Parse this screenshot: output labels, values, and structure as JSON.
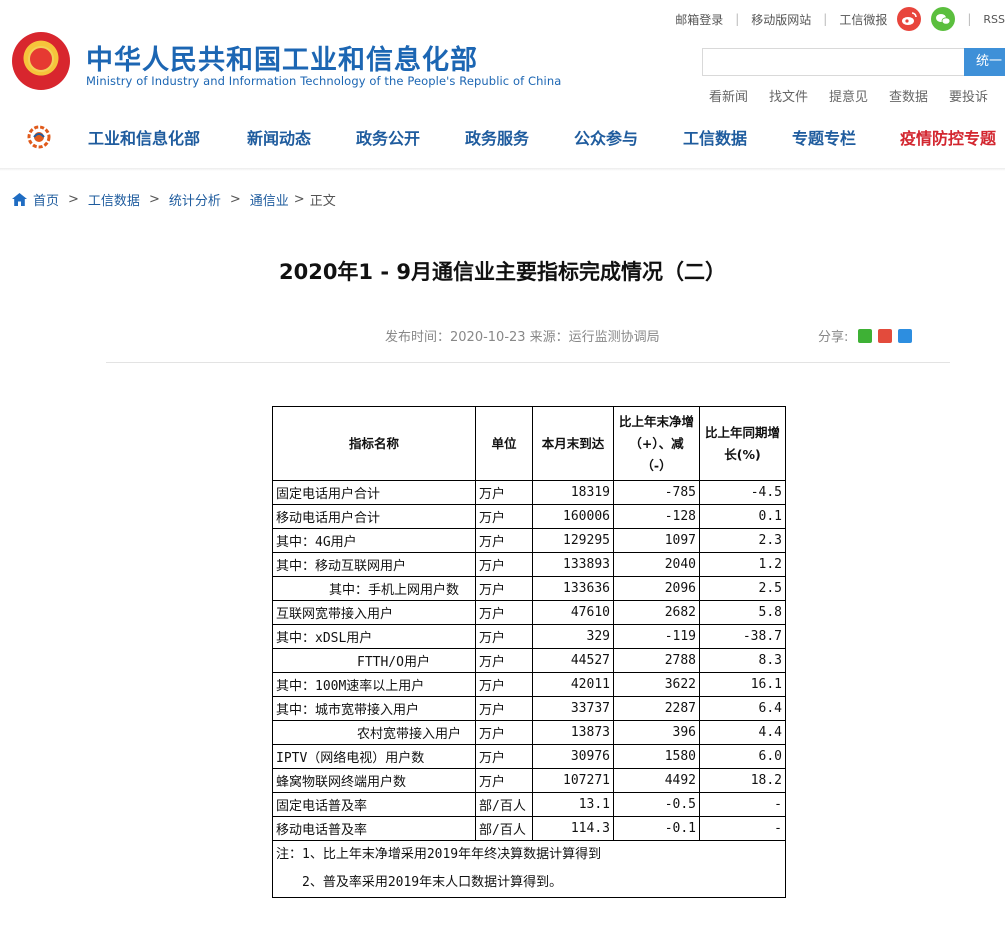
{
  "top_links": [
    "邮箱登录",
    "移动版网站",
    "工信微报"
  ],
  "rss": "RSS",
  "site": {
    "name_cn": "中华人民共和国工业和信息化部",
    "name_en": "Ministry of Industry and Information Technology of the People's Republic of China"
  },
  "search": {
    "button": "统一"
  },
  "quick_links": [
    "看新闻",
    "找文件",
    "提意见",
    "查数据",
    "要投诉"
  ],
  "nav": [
    "工业和信息化部",
    "新闻动态",
    "政务公开",
    "政务服务",
    "公众参与",
    "工信数据",
    "专题专栏",
    "疫情防控专题"
  ],
  "breadcrumb": [
    "首页",
    "工信数据",
    "统计分析",
    "通信业",
    "正文"
  ],
  "article": {
    "title": "2020年1 - 9月通信业主要指标完成情况（二）",
    "meta": "发布时间：2020-10-23  来源：运行监测协调局",
    "share_label": "分享:"
  },
  "table": {
    "headers": [
      "指标名称",
      "单位",
      "本月末到达",
      "比上年末净增（+）、减（-）",
      "比上年同期增长(%)"
    ],
    "header_lines": {
      "net": [
        "比上年末净增",
        "（+）、减",
        "（-）"
      ],
      "growth": [
        "比上年同期增",
        "长(%)"
      ]
    },
    "rows": [
      {
        "name": "固定电话用户合计",
        "indent": 0,
        "unit": "万户",
        "value": "18319",
        "net": "-785",
        "growth": "-4.5"
      },
      {
        "name": "移动电话用户合计",
        "indent": 0,
        "unit": "万户",
        "value": "160006",
        "net": "-128",
        "growth": "0.1"
      },
      {
        "name": "其中：4G用户",
        "indent": 0,
        "unit": "万户",
        "value": "129295",
        "net": "1097",
        "growth": "2.3"
      },
      {
        "name": "其中：移动互联网用户",
        "indent": 0,
        "unit": "万户",
        "value": "133893",
        "net": "2040",
        "growth": "1.2"
      },
      {
        "name": "其中：手机上网用户数",
        "indent": 56,
        "unit": "万户",
        "value": "133636",
        "net": "2096",
        "growth": "2.5"
      },
      {
        "name": "互联网宽带接入用户",
        "indent": 0,
        "unit": "万户",
        "value": "47610",
        "net": "2682",
        "growth": "5.8"
      },
      {
        "name": "其中：xDSL用户",
        "indent": 0,
        "unit": "万户",
        "value": "329",
        "net": "-119",
        "growth": "-38.7"
      },
      {
        "name": "FTTH/O用户",
        "indent": 84,
        "unit": "万户",
        "value": "44527",
        "net": "2788",
        "growth": "8.3"
      },
      {
        "name": "其中：100M速率以上用户",
        "indent": 0,
        "unit": "万户",
        "value": "42011",
        "net": "3622",
        "growth": "16.1"
      },
      {
        "name": "其中：城市宽带接入用户",
        "indent": 0,
        "unit": "万户",
        "value": "33737",
        "net": "2287",
        "growth": "6.4"
      },
      {
        "name": "农村宽带接入用户",
        "indent": 84,
        "unit": "万户",
        "value": "13873",
        "net": "396",
        "growth": "4.4"
      },
      {
        "name": "IPTV（网络电视）用户数",
        "indent": 0,
        "unit": "万户",
        "value": "30976",
        "net": "1580",
        "growth": "6.0"
      },
      {
        "name": "蜂窝物联网终端用户数",
        "indent": 0,
        "unit": "万户",
        "value": "107271",
        "net": "4492",
        "growth": "18.2"
      },
      {
        "name": "固定电话普及率",
        "indent": 0,
        "unit": "部/百人",
        "value": "13.1",
        "net": "-0.5",
        "growth": "-"
      },
      {
        "name": "移动电话普及率",
        "indent": 0,
        "unit": "部/百人",
        "value": "114.3",
        "net": "-0.1",
        "growth": "-"
      }
    ],
    "notes": [
      "注：1、比上年末净增采用2019年年终决算数据计算得到",
      "2、普及率采用2019年末人口数据计算得到。"
    ]
  }
}
